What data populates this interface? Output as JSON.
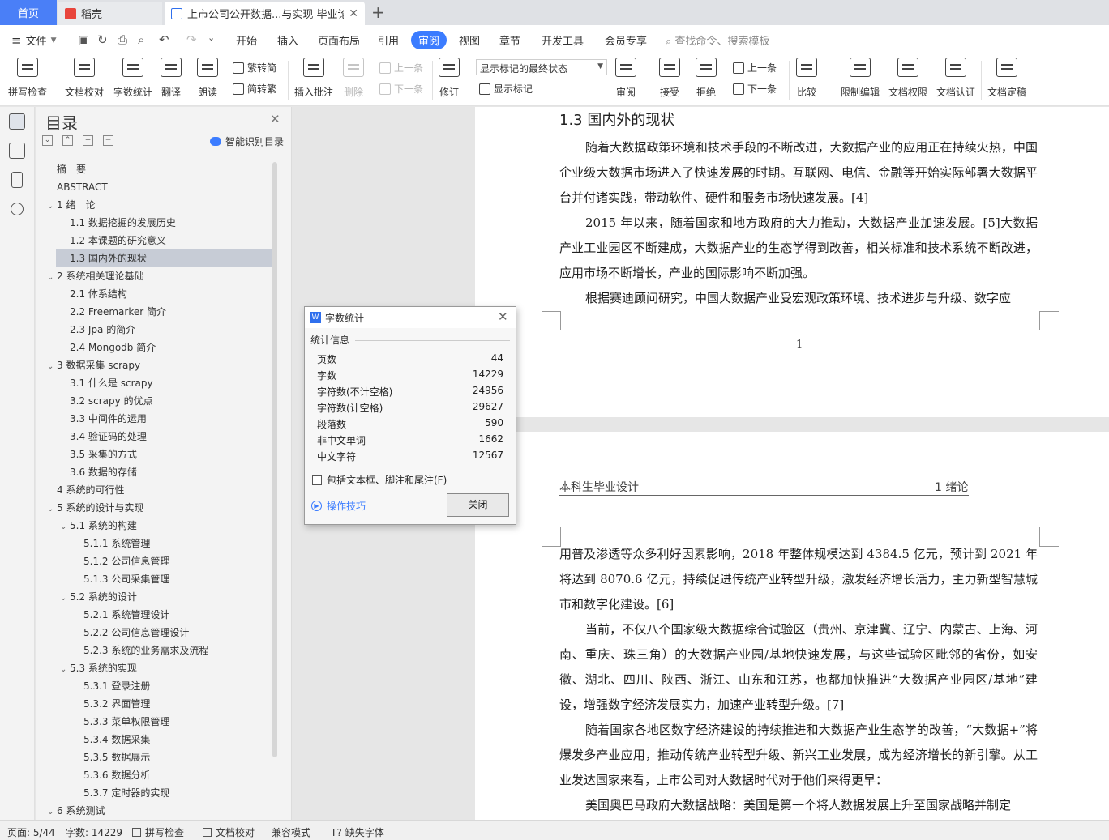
{
  "tabs": {
    "home": "首页",
    "wps": "稻壳",
    "doc": "上市公司公开数据...与实现 毕业论文"
  },
  "menu": {
    "file": "文件",
    "tabs": [
      "开始",
      "插入",
      "页面布局",
      "引用",
      "审阅",
      "视图",
      "章节",
      "开发工具",
      "会员专享"
    ],
    "active": "审阅",
    "search": "查找命令、搜索模板"
  },
  "ribbon": {
    "spell": "拼写检查",
    "proof": "文档校对",
    "wordcount": "字数统计",
    "translate": "翻译",
    "read": "朗读",
    "s2t": "繁转简",
    "t2s": "简转繁",
    "insert_comment": "插入批注",
    "delete": "删除",
    "prev": "上一条",
    "next": "下一条",
    "track": "修订",
    "markup_state": "显示标记的最终状态",
    "show_markup": "显示标记",
    "review": "审阅",
    "accept": "接受",
    "reject": "拒绝",
    "prev2": "上一条",
    "next2": "下一条",
    "compare": "比较",
    "restrict": "限制编辑",
    "permission": "文档权限",
    "certify": "文档认证",
    "finalize": "文档定稿"
  },
  "toc": {
    "title": "目录",
    "smart": "智能识别目录",
    "items": [
      {
        "text": "摘　要",
        "level": 0,
        "caret": ""
      },
      {
        "text": "ABSTRACT",
        "level": 0,
        "caret": ""
      },
      {
        "text": "1 绪　论",
        "level": 0,
        "caret": "⌄"
      },
      {
        "text": "1.1 数据挖掘的发展历史",
        "level": 1,
        "caret": ""
      },
      {
        "text": "1.2 本课题的研究意义",
        "level": 1,
        "caret": ""
      },
      {
        "text": "1.3 国内外的现状",
        "level": 1,
        "caret": "",
        "selected": true
      },
      {
        "text": "2 系统相关理论基础",
        "level": 0,
        "caret": "⌄"
      },
      {
        "text": "2.1 体系结构",
        "level": 1,
        "caret": ""
      },
      {
        "text": "2.2 Freemarker 简介",
        "level": 1,
        "caret": ""
      },
      {
        "text": "2.3 Jpa 的简介",
        "level": 1,
        "caret": ""
      },
      {
        "text": "2.4 Mongodb 简介",
        "level": 1,
        "caret": ""
      },
      {
        "text": "3 数据采集 scrapy",
        "level": 0,
        "caret": "⌄"
      },
      {
        "text": "3.1 什么是 scrapy",
        "level": 1,
        "caret": ""
      },
      {
        "text": "3.2 scrapy 的优点",
        "level": 1,
        "caret": ""
      },
      {
        "text": "3.3 中间件的运用",
        "level": 1,
        "caret": ""
      },
      {
        "text": "3.4 验证码的处理",
        "level": 1,
        "caret": ""
      },
      {
        "text": "3.5 采集的方式",
        "level": 1,
        "caret": ""
      },
      {
        "text": "3.6 数据的存储",
        "level": 1,
        "caret": ""
      },
      {
        "text": "4 系统的可行性",
        "level": 0,
        "caret": ""
      },
      {
        "text": "5 系统的设计与实现",
        "level": 0,
        "caret": "⌄"
      },
      {
        "text": "5.1 系统的构建",
        "level": 1,
        "caret": "⌄"
      },
      {
        "text": "5.1.1 系统管理",
        "level": 2,
        "caret": ""
      },
      {
        "text": "5.1.2 公司信息管理",
        "level": 2,
        "caret": ""
      },
      {
        "text": "5.1.3 公司采集管理",
        "level": 2,
        "caret": ""
      },
      {
        "text": "5.2 系统的设计",
        "level": 1,
        "caret": "⌄"
      },
      {
        "text": "5.2.1 系统管理设计",
        "level": 2,
        "caret": ""
      },
      {
        "text": "5.2.2 公司信息管理设计",
        "level": 2,
        "caret": ""
      },
      {
        "text": "5.2.3 系统的业务需求及流程",
        "level": 2,
        "caret": ""
      },
      {
        "text": "5.3 系统的实现",
        "level": 1,
        "caret": "⌄"
      },
      {
        "text": "5.3.1 登录注册",
        "level": 2,
        "caret": ""
      },
      {
        "text": "5.3.2 界面管理",
        "level": 2,
        "caret": ""
      },
      {
        "text": "5.3.3 菜单权限管理",
        "level": 2,
        "caret": ""
      },
      {
        "text": "5.3.4 数据采集",
        "level": 2,
        "caret": ""
      },
      {
        "text": "5.3.5 数据展示",
        "level": 2,
        "caret": ""
      },
      {
        "text": "5.3.6 数据分析",
        "level": 2,
        "caret": ""
      },
      {
        "text": "5.3.7 定时器的实现",
        "level": 2,
        "caret": ""
      },
      {
        "text": "6 系统测试",
        "level": 0,
        "caret": "⌄"
      }
    ]
  },
  "page1": {
    "heading": "1.3 国内外的现状",
    "paragraphs": [
      "随着大数据政策环境和技术手段的不断改进，大数据产业的应用正在持续火热，中国企业级大数据市场进入了快速发展的时期。互联网、电信、金融等开始实际部署大数据平台并付诸实践，带动软件、硬件和服务市场快速发展。[4]",
      "2015 年以来，随着国家和地方政府的大力推动，大数据产业加速发展。[5]大数据产业工业园区不断建成，大数据产业的生态学得到改善，相关标准和技术系统不断改进，应用市场不断增长，产业的国际影响不断加强。",
      "根据赛迪顾问研究，中国大数据产业受宏观政策环境、技术进步与升级、数字应"
    ],
    "page_number": "1"
  },
  "page2": {
    "header_left": "本科生毕业设计",
    "header_right": "1 绪论",
    "paragraphs": [
      "用普及渗透等众多利好因素影响，2018 年整体规模达到 4384.5 亿元，预计到 2021 年将达到 8070.6 亿元，持续促进传统产业转型升级，激发经济增长活力，主力新型智慧城市和数字化建设。[6]",
      "当前，不仅八个国家级大数据综合试验区（贵州、京津冀、辽宁、内蒙古、上海、河南、重庆、珠三角）的大数据产业园/基地快速发展，与这些试验区毗邻的省份，如安徽、湖北、四川、陕西、浙江、山东和江苏，也都加快推进“大数据产业园区/基地”建设，增强数字经济发展实力，加速产业转型升级。[7]",
      "随着国家各地区数字经济建设的持续推进和大数据产业生态学的改善，“大数据+”将爆发多产业应用，推动传统产业转型升级、新兴工业发展，成为经济增长的新引擎。从工业发达国家来看，上市公司对大数据时代对于他们来得更早：",
      "美国奥巴马政府大数据战略：美国是第一个将人数据发展上升至国家战略并制定"
    ]
  },
  "dialog": {
    "title": "字数统计",
    "group": "统计信息",
    "rows": [
      {
        "label": "页数",
        "value": "44"
      },
      {
        "label": "字数",
        "value": "14229"
      },
      {
        "label": "字符数(不计空格)",
        "value": "24956"
      },
      {
        "label": "字符数(计空格)",
        "value": "29627"
      },
      {
        "label": "段落数",
        "value": "590"
      },
      {
        "label": "非中文单词",
        "value": "1662"
      },
      {
        "label": "中文字符",
        "value": "12567"
      }
    ],
    "checkbox": "包括文本框、脚注和尾注(F)",
    "tips": "操作技巧",
    "close": "关闭"
  },
  "status": {
    "page": "页面: 5/44",
    "words": "字数: 14229",
    "spell": "拼写检查",
    "proof": "文档校对",
    "compat": "兼容模式",
    "font": "缺失字体"
  }
}
